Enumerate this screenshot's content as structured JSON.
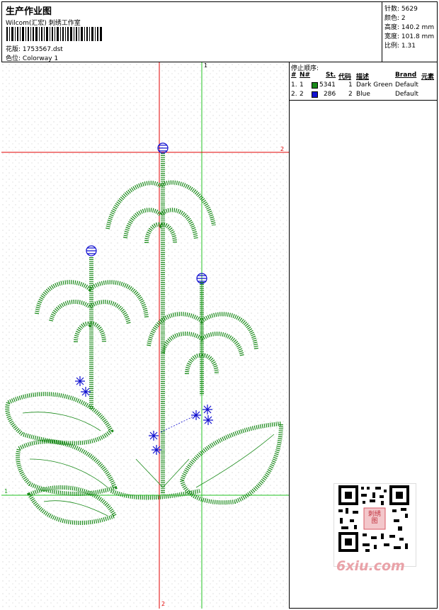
{
  "header": {
    "title": "生产作业图",
    "company": "Wilcom(汇宏) 刺绣工作室",
    "design_label": "花版:",
    "design_file": "1753567.dst",
    "colorway_label": "色位:",
    "colorway": "Colorway 1"
  },
  "stats": [
    {
      "label": "针数",
      "value": "5629"
    },
    {
      "label": "颜色",
      "value": "2"
    },
    {
      "label": "高度",
      "value": "140.2 mm"
    },
    {
      "label": "宽度",
      "value": "101.8 mm"
    },
    {
      "label": "比例",
      "value": "1.31"
    }
  ],
  "stop_sequence": {
    "title": "停止顺序:",
    "columns": [
      "#",
      "N#",
      "St.",
      "代码",
      "描述",
      "Brand",
      "元素"
    ],
    "rows": [
      {
        "index": "1.",
        "needle": "1",
        "stitches": "5341",
        "code": "1",
        "description": "Dark Green",
        "brand": "Default",
        "color": "#1a8a1a"
      },
      {
        "index": "2.",
        "needle": "2",
        "stitches": "286",
        "code": "2",
        "description": "Blue",
        "brand": "Default",
        "color": "#1010d0"
      }
    ]
  },
  "guides": {
    "vertical_green_label": "1",
    "horizontal_red_label": "2",
    "horizontal_green_label": "1",
    "vertical_red_label": "2"
  },
  "watermark": {
    "text": "6xiu.com",
    "badge": "刺绣图"
  },
  "colors": {
    "green_thread": "#1a8a1a",
    "blue_thread": "#1010d0",
    "guide_red": "#e00000",
    "guide_green": "#20c020"
  }
}
